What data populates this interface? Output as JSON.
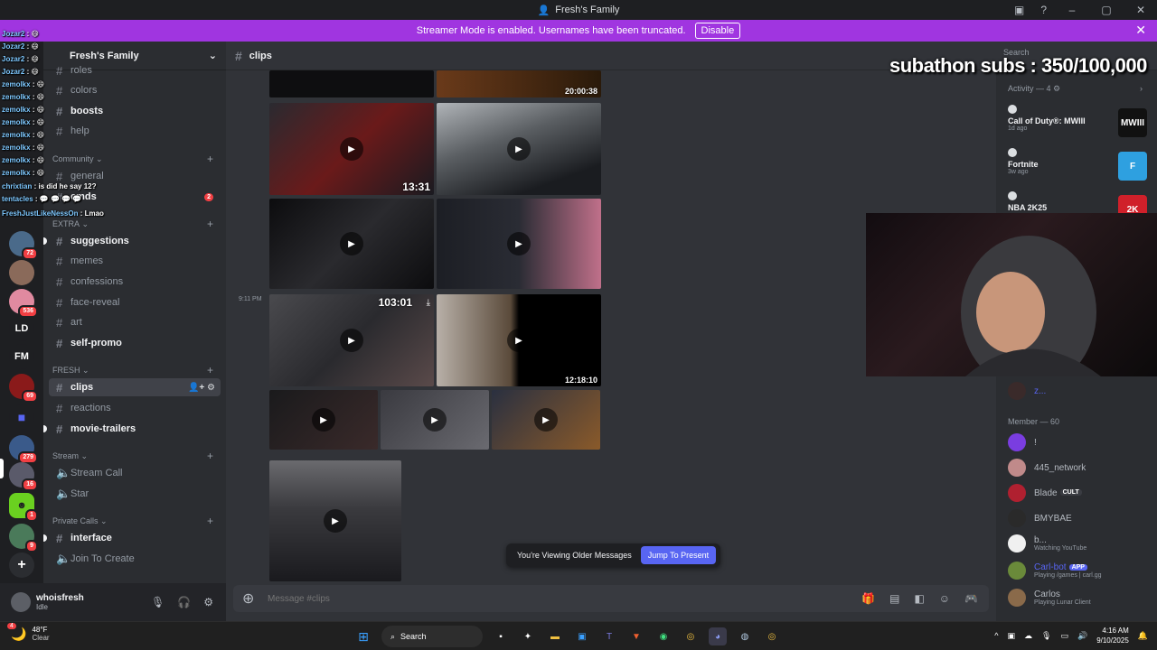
{
  "window": {
    "title": "Fresh's Family"
  },
  "banner": {
    "text": "Streamer Mode is enabled. Usernames have been truncated.",
    "disable_label": "Disable"
  },
  "server": {
    "name": "Fresh's Family"
  },
  "rail": {
    "badges": [
      "72",
      "536",
      "69",
      "279",
      "16",
      "1",
      "9"
    ],
    "labels": [
      "LD",
      "FM"
    ]
  },
  "channels": [
    {
      "label": "roles"
    },
    {
      "label": "colors"
    },
    {
      "label": "boosts"
    },
    {
      "label": "help"
    },
    {
      "label": "general"
    },
    {
      "label": "cmds"
    },
    {
      "label": "suggestions"
    },
    {
      "label": "memes"
    },
    {
      "label": "confessions"
    },
    {
      "label": "face-reveal"
    },
    {
      "label": "art"
    },
    {
      "label": "self-promo"
    },
    {
      "label": "clips"
    },
    {
      "label": "reactions"
    },
    {
      "label": "movie-trailers"
    },
    {
      "label": "Stream Call"
    },
    {
      "label": "Star"
    },
    {
      "label": "interface"
    },
    {
      "label": "Join To Create"
    }
  ],
  "categories": {
    "community": "Community",
    "extra": "EXTRA",
    "fresh": "FRESH",
    "stream": "Stream",
    "private_calls": "Private Calls"
  },
  "mention_count": "2",
  "user": {
    "name": "whoisfresh",
    "status": "Idle"
  },
  "overlay_chat": [
    {
      "name": "Jozar2",
      "msg": ": 😄"
    },
    {
      "name": "Jozar2",
      "msg": ": 😄"
    },
    {
      "name": "Jozar2",
      "msg": ": 😄"
    },
    {
      "name": "Jozar2",
      "msg": ": 😄"
    },
    {
      "name": "zemolkx",
      "msg": ": 😄"
    },
    {
      "name": "zemolkx",
      "msg": ": 😄"
    },
    {
      "name": "zemolkx",
      "msg": ": 😄"
    },
    {
      "name": "zemolkx",
      "msg": ": 😄"
    },
    {
      "name": "zemolkx",
      "msg": ": 😄"
    },
    {
      "name": "zemolkx",
      "msg": ": 😄"
    },
    {
      "name": "zemolkx",
      "msg": ": 😄"
    },
    {
      "name": "zemolkx",
      "msg": ": 😄"
    },
    {
      "name": "chrixtian",
      "msg": ": is did he say 12?"
    },
    {
      "name": "tentacles",
      "msg": ": 💬 💬 💬 💬"
    },
    {
      "name": "FreshJustLikeNessOn",
      "msg": ": Lmao"
    }
  ],
  "chat": {
    "channel": "clips",
    "timestamp": "9:11 PM",
    "durations": [
      "20:00:38",
      "13:31",
      "103:01",
      "12:18:10"
    ],
    "older_text": "You're Viewing Older Messages",
    "jump_label": "Jump To Present",
    "composer_placeholder": "Message #clips"
  },
  "right": {
    "search_placeholder": "Search",
    "activity_label": "Activity — 4",
    "activities": [
      {
        "name": "Call of Duty®: MWIII",
        "time": "1d ago",
        "logo": "MWIII",
        "color": "#111111"
      },
      {
        "name": "Fortnite",
        "time": "3w ago",
        "logo": "F",
        "color": "#2ea0e0"
      },
      {
        "name": "NBA 2K25",
        "time": "",
        "logo": "2K",
        "color": "#d0202a"
      }
    ],
    "member_label": "Member — 60",
    "members": [
      {
        "name": "!",
        "status": "",
        "tag": "",
        "color": "#7a3de0"
      },
      {
        "name": "445_network",
        "status": "",
        "tag": "",
        "color": "#c08a8a"
      },
      {
        "name": "Blade",
        "status": "",
        "tag": "CULT",
        "color": "#b02030"
      },
      {
        "name": "BMYBAE",
        "status": "",
        "tag": "",
        "color": "#2a2a2a"
      },
      {
        "name": "b...",
        "status": "Watching YouTube",
        "tag": "",
        "color": "#f0f0f0"
      },
      {
        "name": "Carl-bot",
        "status": "Playing /games | carl.gg",
        "tag": "APP",
        "color": "#6a8a3a"
      },
      {
        "name": "Carlos",
        "status": "Playing Lunar Client",
        "tag": "",
        "color": "#8a6a4a"
      }
    ],
    "top_member_label": "z..."
  },
  "overlay": {
    "subathon": "subathon subs : 350/100,000"
  },
  "taskbar": {
    "temp": "48°F",
    "condition": "Clear",
    "search": "Search",
    "time": "4:16 AM",
    "date": "9/10/2025",
    "weather_badge": "4"
  }
}
